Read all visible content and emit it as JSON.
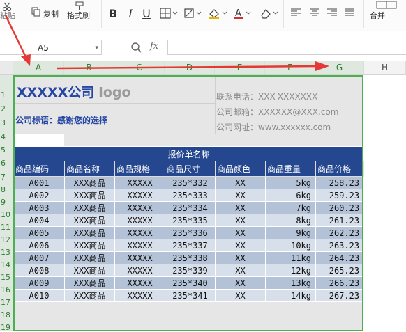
{
  "ribbon": {
    "paste_label": "粘贴",
    "copy_label": "复制",
    "format_painter_label": "格式刷",
    "merge_label": "合并",
    "font_buttons": [
      "B",
      "I",
      "U"
    ],
    "icons": [
      "cut-icon",
      "copy-icon",
      "format-painter-icon",
      "bold-icon",
      "italic-icon",
      "underline-icon",
      "border-icon",
      "fill-color-icon",
      "font-color-icon",
      "clear-format-icon",
      "align-left-icon",
      "align-center-icon",
      "align-right-icon",
      "justify-icon",
      "merge-icon"
    ]
  },
  "formula_bar": {
    "cell_ref": "A5",
    "fx_label": "fx",
    "formula_value": ""
  },
  "columns": [
    "A",
    "B",
    "C",
    "D",
    "E",
    "F",
    "G",
    "H"
  ],
  "selected_columns": [
    "A",
    "B",
    "C",
    "D",
    "E",
    "F",
    "G"
  ],
  "rows": [
    "1",
    "2",
    "3",
    "4",
    "5",
    "6",
    "7",
    "8",
    "9",
    "10",
    "11",
    "12",
    "13",
    "14",
    "15",
    "16",
    "17",
    "18",
    "19"
  ],
  "company": {
    "name": "XXXXX公司",
    "logo_text": "logo",
    "slogan": "公司标语：感谢您的选择",
    "phone": "联系电话：XXX-XXXXXXX",
    "email": "公司邮箱：XXXXXX@XXX.com",
    "website": "公司网址：www.xxxxxx.com"
  },
  "table": {
    "title": "报价单名称",
    "headers": [
      "商品编码",
      "商品名称",
      "商品规格",
      "商品尺寸",
      "商品颜色",
      "商品重量",
      "商品价格"
    ],
    "rows": [
      [
        "A001",
        "XXX商品",
        "XXXXX",
        "235*332",
        "XX",
        "5kg",
        "258.23"
      ],
      [
        "A002",
        "XXX商品",
        "XXXXX",
        "235*333",
        "XX",
        "6kg",
        "259.23"
      ],
      [
        "A003",
        "XXX商品",
        "XXXXX",
        "235*334",
        "XX",
        "7kg",
        "260.23"
      ],
      [
        "A004",
        "XXX商品",
        "XXXXX",
        "235*335",
        "XX",
        "8kg",
        "261.23"
      ],
      [
        "A005",
        "XXX商品",
        "XXXXX",
        "235*336",
        "XX",
        "9kg",
        "262.23"
      ],
      [
        "A006",
        "XXX商品",
        "XXXXX",
        "235*337",
        "XX",
        "10kg",
        "263.23"
      ],
      [
        "A007",
        "XXX商品",
        "XXXXX",
        "235*338",
        "XX",
        "11kg",
        "264.23"
      ],
      [
        "A008",
        "XXX商品",
        "XXXXX",
        "235*339",
        "XX",
        "12kg",
        "265.23"
      ],
      [
        "A009",
        "XXX商品",
        "XXXXX",
        "235*340",
        "XX",
        "13kg",
        "266.23"
      ],
      [
        "A010",
        "XXX商品",
        "XXXXX",
        "235*341",
        "XX",
        "14kg",
        "267.23"
      ]
    ]
  },
  "colors": {
    "header_blue": "#24478f",
    "row_dark": "#b3c2d6",
    "row_light": "#d6dfea",
    "selection_green": "#4caf50",
    "annotation_red": "#e53935"
  }
}
